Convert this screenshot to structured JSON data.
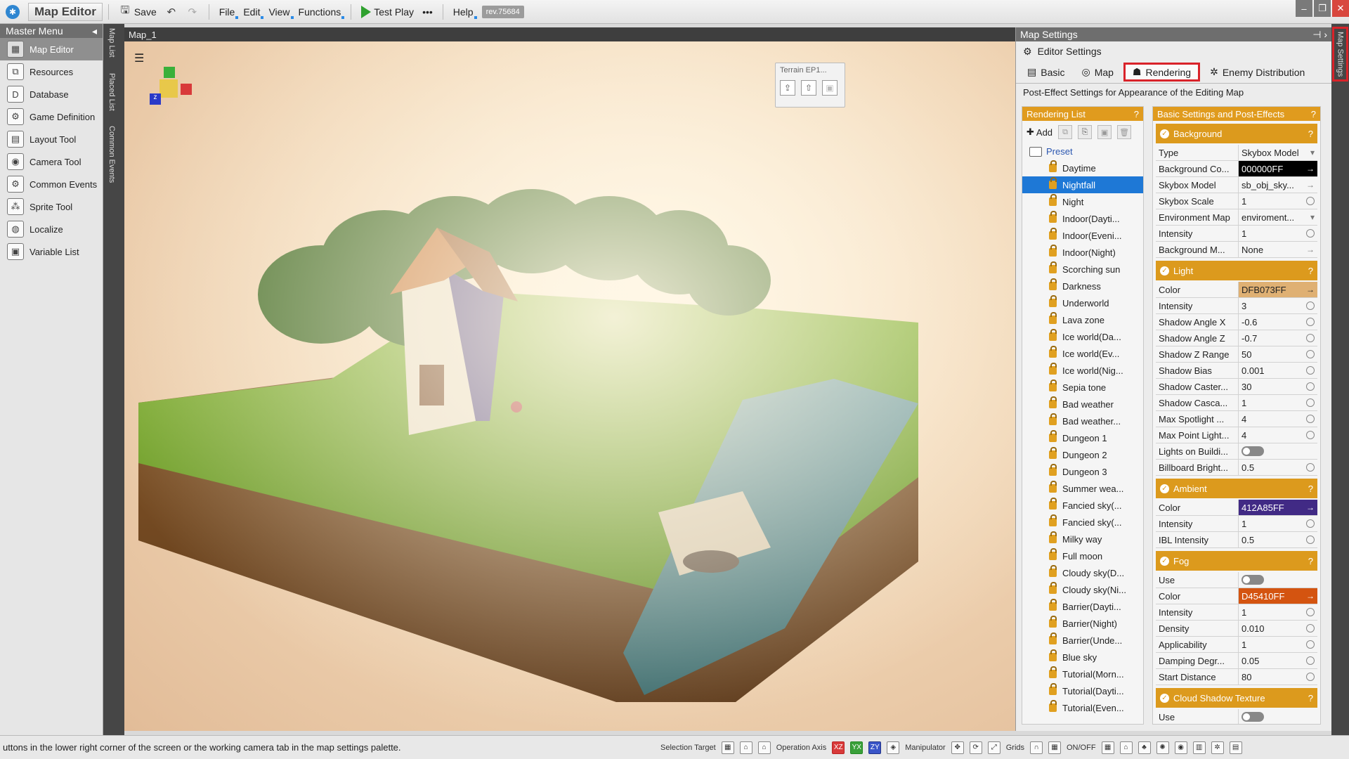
{
  "app": {
    "title": "Map Editor",
    "revision": "rev.75684"
  },
  "toolbar": {
    "save_label": "Save",
    "menus": [
      "File",
      "Edit",
      "View",
      "Functions"
    ],
    "test_play_label": "Test Play",
    "more_label": "•••",
    "help_label": "Help"
  },
  "master_menu": {
    "title": "Master Menu",
    "items": [
      {
        "label": "Map Editor",
        "icon": "map-icon"
      },
      {
        "label": "Resources",
        "icon": "resources-icon"
      },
      {
        "label": "Database",
        "icon": "database-icon"
      },
      {
        "label": "Game Definition",
        "icon": "game-definition-icon"
      },
      {
        "label": "Layout Tool",
        "icon": "layout-icon"
      },
      {
        "label": "Camera Tool",
        "icon": "camera-icon"
      },
      {
        "label": "Common Events",
        "icon": "events-icon"
      },
      {
        "label": "Sprite Tool",
        "icon": "sprite-icon"
      },
      {
        "label": "Localize",
        "icon": "localize-icon"
      },
      {
        "label": "Variable List",
        "icon": "variable-icon"
      }
    ]
  },
  "side_tabs": [
    "Map List",
    "Placed List",
    "Common Events"
  ],
  "viewport": {
    "tab_title": "Map_1",
    "terrain_popup_title": "Terrain EP1..."
  },
  "map_settings": {
    "title": "Map Settings",
    "side_tab_label": "Map Settings",
    "editor_settings_label": "Editor Settings",
    "tabs": [
      "Basic",
      "Map",
      "Rendering",
      "Enemy Distribution"
    ],
    "active_tab": "Rendering",
    "subtitle": "Post-Effect Settings for Appearance of the Editing Map",
    "rendering_list": {
      "title": "Rendering List",
      "add_label": "Add",
      "folder_label": "Preset",
      "selected": "Nightfall",
      "items": [
        "Daytime",
        "Nightfall",
        "Night",
        "Indoor(Dayti...",
        "Indoor(Eveni...",
        "Indoor(Night)",
        "Scorching sun",
        "Darkness",
        "Underworld",
        "Lava zone",
        "Ice world(Da...",
        "Ice world(Ev...",
        "Ice world(Nig...",
        "Sepia tone",
        "Bad weather",
        "Bad weather...",
        "Dungeon 1",
        "Dungeon 2",
        "Dungeon 3",
        "Summer wea...",
        "Fancied sky(...",
        "Fancied sky(...",
        "Milky way",
        "Full moon",
        "Cloudy sky(D...",
        "Cloudy sky(Ni...",
        "Barrier(Dayti...",
        "Barrier(Night)",
        "Barrier(Unde...",
        "Blue sky",
        "Tutorial(Morn...",
        "Tutorial(Dayti...",
        "Tutorial(Even..."
      ]
    },
    "settings_panel": {
      "title": "Basic Settings and Post-Effects",
      "sections": [
        {
          "name": "Background",
          "props": [
            {
              "label": "Type",
              "value": "Skybox Model",
              "ctrl": "dropdown"
            },
            {
              "label": "Background Co...",
              "value": "000000FF",
              "ctrl": "color",
              "color": "#000000",
              "text_color": "#ffffff"
            },
            {
              "label": "Skybox Model",
              "value": "sb_obj_sky...",
              "ctrl": "arrow"
            },
            {
              "label": "Skybox Scale",
              "value": "1",
              "ctrl": "reset"
            },
            {
              "label": "Environment Map",
              "value": "enviroment...",
              "ctrl": "dropdown"
            },
            {
              "label": "Intensity",
              "value": "1",
              "ctrl": "reset"
            },
            {
              "label": "Background M...",
              "value": "None",
              "ctrl": "arrow"
            }
          ]
        },
        {
          "name": "Light",
          "props": [
            {
              "label": "Color",
              "value": "DFB073FF",
              "ctrl": "color",
              "color": "#DFB073",
              "text_color": "#222222"
            },
            {
              "label": "Intensity",
              "value": "3",
              "ctrl": "reset"
            },
            {
              "label": "Shadow Angle X",
              "value": "-0.6",
              "ctrl": "reset"
            },
            {
              "label": "Shadow Angle Z",
              "value": "-0.7",
              "ctrl": "reset"
            },
            {
              "label": "Shadow Z Range",
              "value": "50",
              "ctrl": "reset"
            },
            {
              "label": "Shadow Bias",
              "value": "0.001",
              "ctrl": "reset"
            },
            {
              "label": "Shadow Caster...",
              "value": "30",
              "ctrl": "reset"
            },
            {
              "label": "Shadow Casca...",
              "value": "1",
              "ctrl": "reset"
            },
            {
              "label": "Max Spotlight ...",
              "value": "4",
              "ctrl": "reset"
            },
            {
              "label": "Max Point Light...",
              "value": "4",
              "ctrl": "reset"
            },
            {
              "label": "Lights on Buildi...",
              "value": "",
              "ctrl": "toggle"
            },
            {
              "label": "Billboard Bright...",
              "value": "0.5",
              "ctrl": "reset"
            }
          ]
        },
        {
          "name": "Ambient",
          "props": [
            {
              "label": "Color",
              "value": "412A85FF",
              "ctrl": "color",
              "color": "#412A85",
              "text_color": "#ffffff"
            },
            {
              "label": "Intensity",
              "value": "1",
              "ctrl": "reset"
            },
            {
              "label": "IBL Intensity",
              "value": "0.5",
              "ctrl": "reset"
            }
          ]
        },
        {
          "name": "Fog",
          "props": [
            {
              "label": "Use",
              "value": "",
              "ctrl": "toggle"
            },
            {
              "label": "Color",
              "value": "D45410FF",
              "ctrl": "color",
              "color": "#D45410",
              "text_color": "#ffffff"
            },
            {
              "label": "Intensity",
              "value": "1",
              "ctrl": "reset"
            },
            {
              "label": "Density",
              "value": "0.010",
              "ctrl": "reset"
            },
            {
              "label": "Applicability",
              "value": "1",
              "ctrl": "reset"
            },
            {
              "label": "Damping Degr...",
              "value": "0.05",
              "ctrl": "reset"
            },
            {
              "label": "Start Distance",
              "value": "80",
              "ctrl": "reset"
            }
          ]
        },
        {
          "name": "Cloud Shadow Texture",
          "props": [
            {
              "label": "Use",
              "value": "",
              "ctrl": "toggle"
            }
          ]
        }
      ]
    }
  },
  "status_bar": {
    "message": "uttons in the lower right corner of the screen or the working camera tab in the map settings palette.",
    "selection_target_label": "Selection Target",
    "operation_axis_label": "Operation Axis",
    "manipulator_label": "Manipulator",
    "grids_label": "Grids",
    "onoff_label": "ON/OFF"
  },
  "colors": {
    "accent_orange": "#dc9a1d",
    "selection_blue": "#1e78d6",
    "highlight_red": "#d9232a"
  }
}
